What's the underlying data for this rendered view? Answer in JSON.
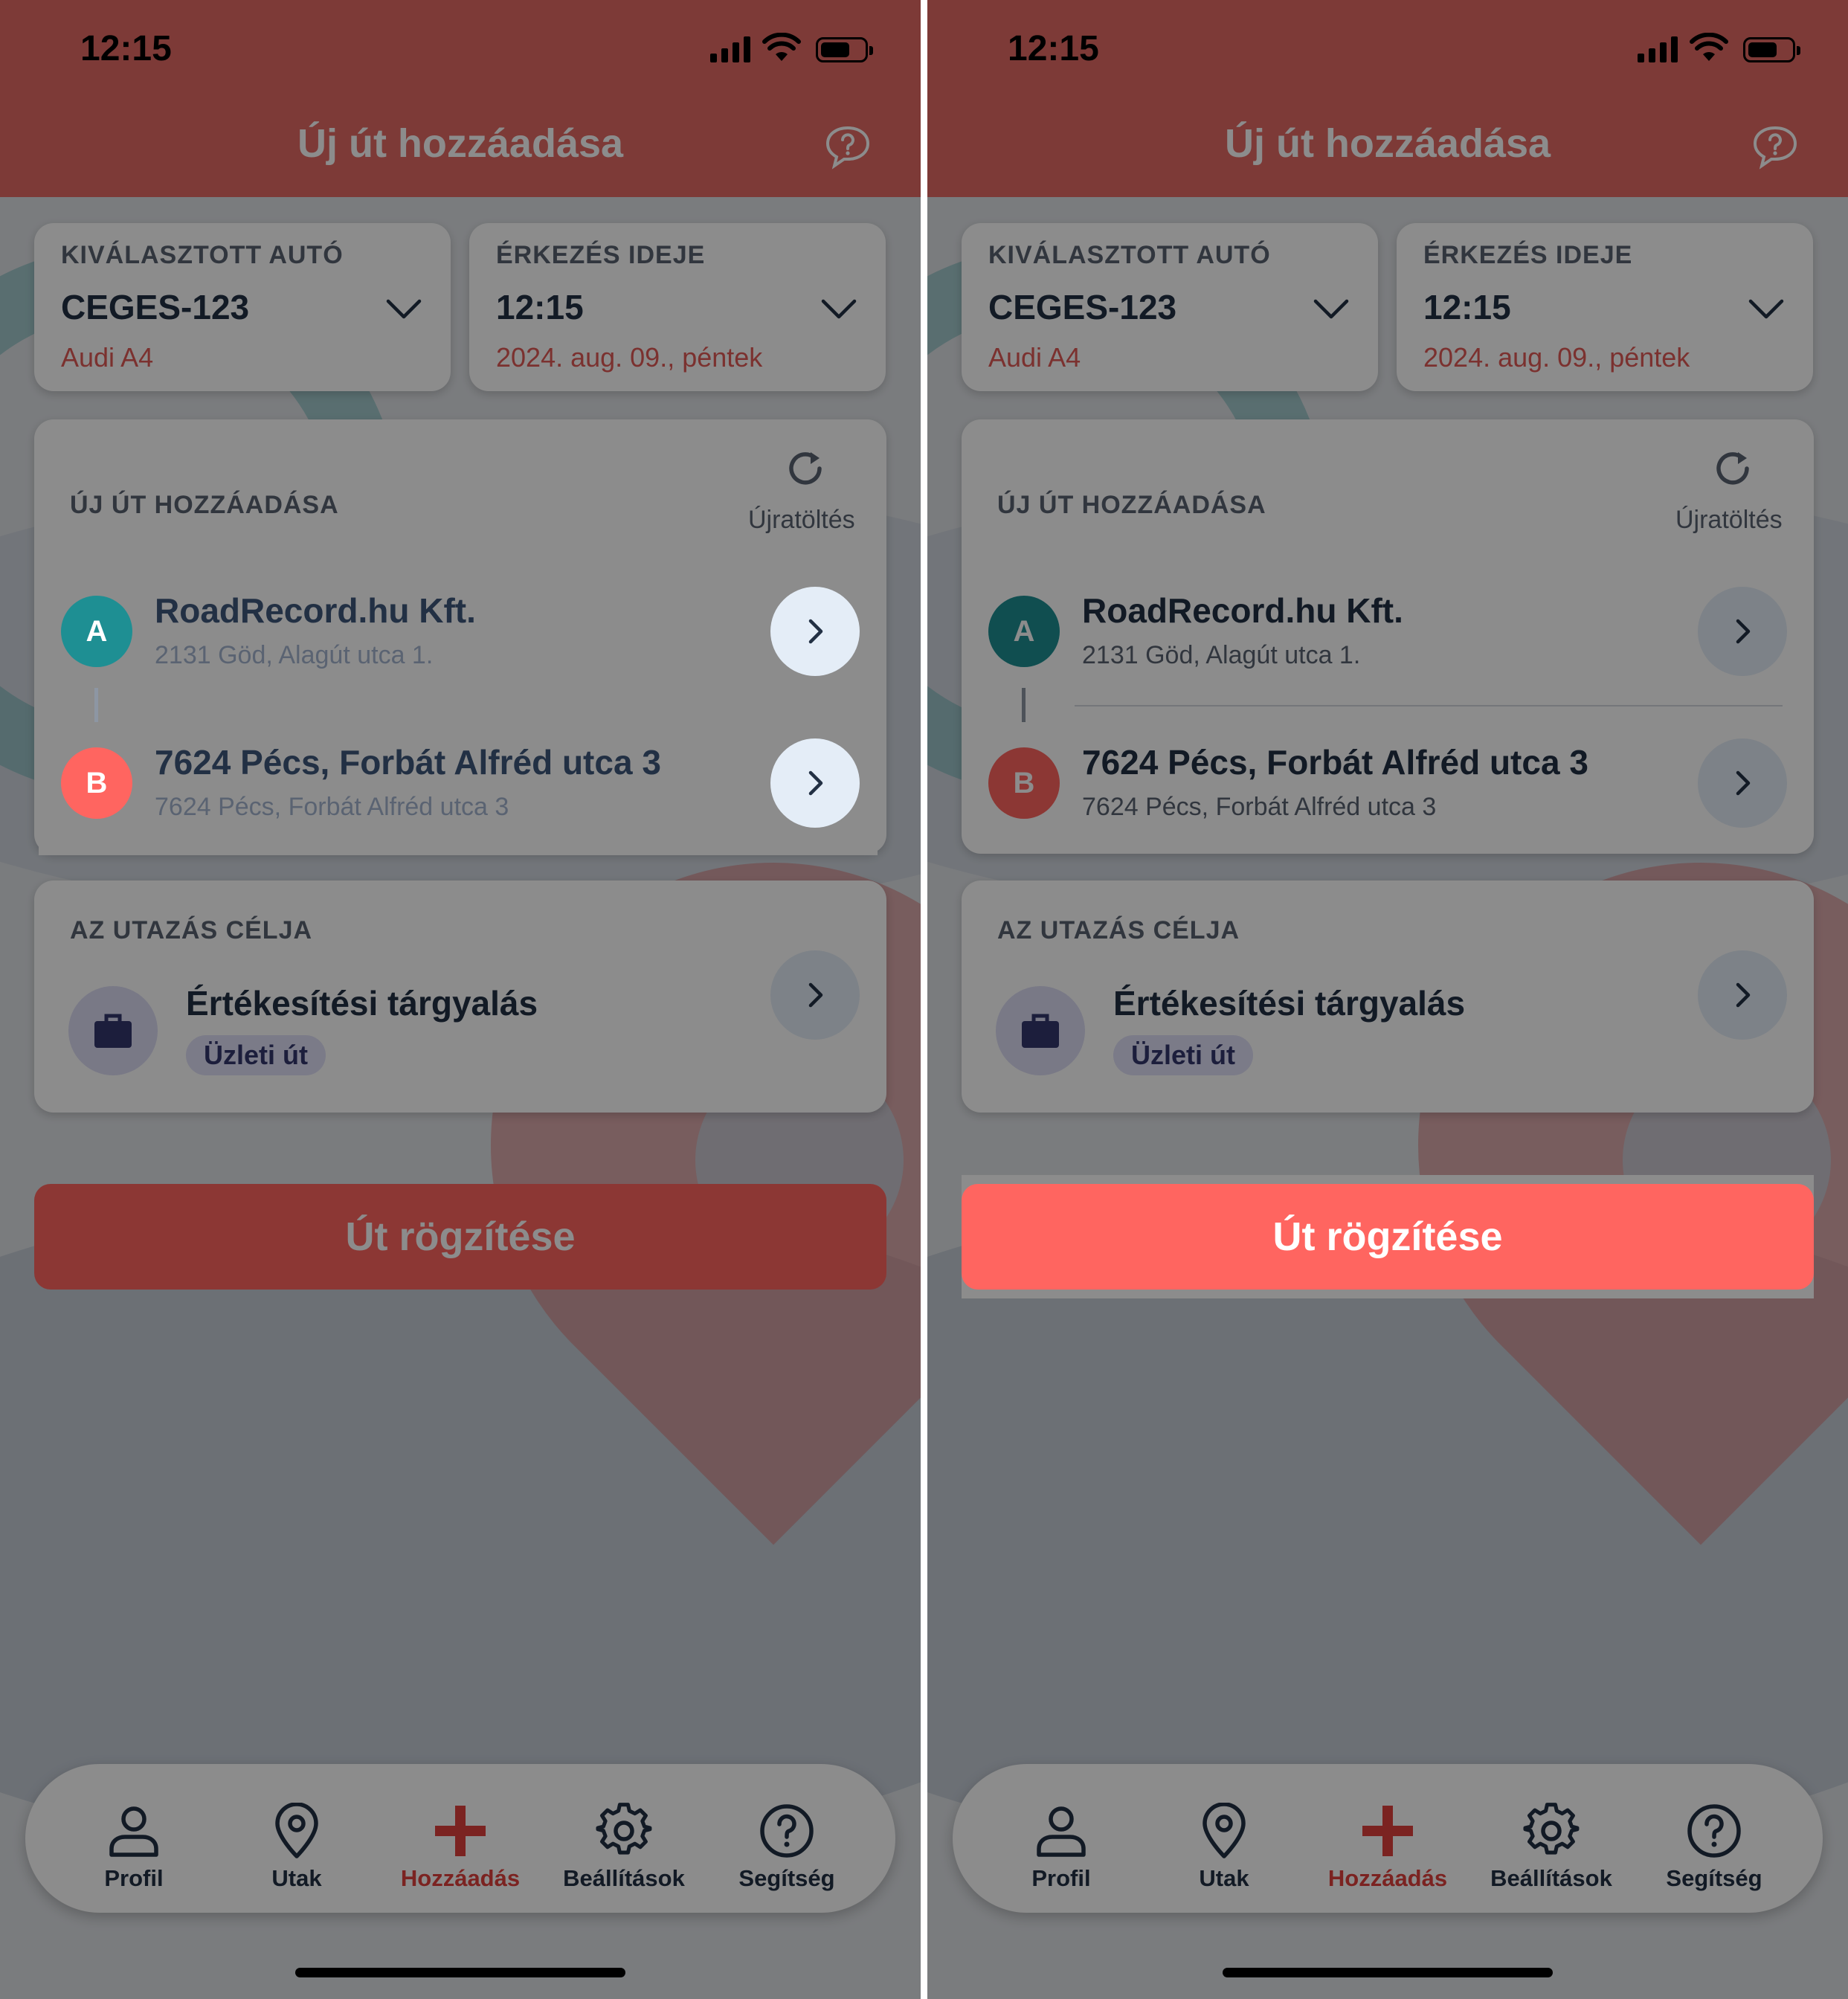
{
  "colors": {
    "brand_red": "#e36a64",
    "accent_button": "#ff6560",
    "marker_a": "#1e8f93",
    "marker_b": "#ff6560",
    "active_tab": "#e0403c",
    "text_dark": "#223044"
  },
  "screens": [
    {
      "status": {
        "time": "12:15"
      },
      "appbar": {
        "title": "Új út hozzáadása",
        "help_icon": "chat-question-icon"
      },
      "car": {
        "label": "KIVÁLASZTOTT AUTÓ",
        "plate": "CEGES-123",
        "model": "Audi A4"
      },
      "arrival": {
        "label": "ÉRKEZÉS IDEJE",
        "time": "12:15",
        "date": "2024. aug. 09., péntek"
      },
      "route": {
        "label": "ÚJ ÚT HOZZÁADÁSA",
        "reload_label": "Újratöltés",
        "points": [
          {
            "marker": "A",
            "title": "RoadRecord.hu Kft.",
            "address": "2131 Göd, Alagút utca 1."
          },
          {
            "marker": "B",
            "title": "7624 Pécs, Forbát Alfréd utca 3",
            "address": "7624 Pécs, Forbát Alfréd utca 3"
          }
        ]
      },
      "purpose": {
        "label": "AZ UTAZÁS CÉLJA",
        "title": "Értékesítési tárgyalás",
        "chip": "Üzleti út",
        "icon": "briefcase-icon"
      },
      "record_button": "Út rögzítése",
      "highlight": "destination-b"
    },
    {
      "status": {
        "time": "12:15"
      },
      "appbar": {
        "title": "Új út hozzáadása",
        "help_icon": "chat-question-icon"
      },
      "car": {
        "label": "KIVÁLASZTOTT AUTÓ",
        "plate": "CEGES-123",
        "model": "Audi A4"
      },
      "arrival": {
        "label": "ÉRKEZÉS IDEJE",
        "time": "12:15",
        "date": "2024. aug. 09., péntek"
      },
      "route": {
        "label": "ÚJ ÚT HOZZÁADÁSA",
        "reload_label": "Újratöltés",
        "points": [
          {
            "marker": "A",
            "title": "RoadRecord.hu Kft.",
            "address": "2131 Göd, Alagút utca 1."
          },
          {
            "marker": "B",
            "title": "7624 Pécs, Forbát Alfréd utca 3",
            "address": "7624 Pécs, Forbát Alfréd utca 3"
          }
        ]
      },
      "purpose": {
        "label": "AZ UTAZÁS CÉLJA",
        "title": "Értékesítési tárgyalás",
        "chip": "Üzleti út",
        "icon": "briefcase-icon"
      },
      "record_button": "Út rögzítése",
      "highlight": "record-button"
    }
  ],
  "tabs": [
    {
      "label": "Profil",
      "icon": "person-icon"
    },
    {
      "label": "Utak",
      "icon": "map-pin-icon"
    },
    {
      "label": "Hozzáadás",
      "icon": "plus-icon",
      "active": true
    },
    {
      "label": "Beállítások",
      "icon": "gear-icon"
    },
    {
      "label": "Segítség",
      "icon": "help-circle-icon"
    }
  ]
}
